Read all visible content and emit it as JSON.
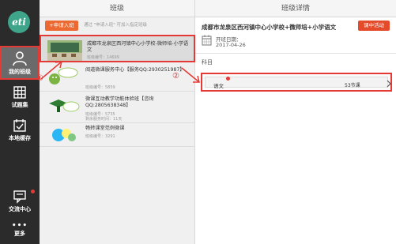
{
  "sidebar": {
    "logo_text": "eti",
    "items": [
      {
        "label": "我的班级",
        "icon": "person-icon",
        "active": true
      },
      {
        "label": "试题集",
        "icon": "grid-icon"
      },
      {
        "label": "本地缓存",
        "icon": "calendar-check-icon"
      },
      {
        "label": "交流中心",
        "icon": "chat-icon",
        "badge": true
      },
      {
        "label": "更多",
        "icon": "more-dots-icon"
      }
    ]
  },
  "class_panel": {
    "title": "班级",
    "apply_button": "+申请入班",
    "apply_tip": "通过  \"申请入班\"  可加入指定班级",
    "items": [
      {
        "title": "成都市龙泉区西河镇中心小学校-微师培-小学语文",
        "number": "班级编号：14699",
        "thumb": "classroom"
      },
      {
        "title": "阅道微课服务中心【服务QQ:2930251987】",
        "number": "班级编号：5859",
        "thumb": "hello"
      },
      {
        "title": "微课互动教学功能体验班【咨询QQ:2805638348】",
        "number": "班级编号：5735",
        "extra": "剩余服务时间：11天",
        "thumb": "welcome"
      },
      {
        "title": "畅转课堂范例微课",
        "number": "班级编号：3291",
        "thumb": "smooth"
      }
    ]
  },
  "detail_panel": {
    "title": "班级详情",
    "class_name": "成都市龙泉区西河镇中心小学校+微师培+小学语文",
    "activity_button": "课中活动",
    "start_label": "开班日期：",
    "start_date": "2017-04-26",
    "subject_header": "科目",
    "subjects": [
      {
        "name": "语文",
        "count": "53节课"
      }
    ]
  },
  "annotations": {
    "one": "①",
    "two": "②"
  },
  "colors": {
    "sidebar_bg": "#2b2b2b",
    "accent_orange": "#ec6a32",
    "highlight_red": "#e53935",
    "logo_green": "#3fa58a"
  }
}
